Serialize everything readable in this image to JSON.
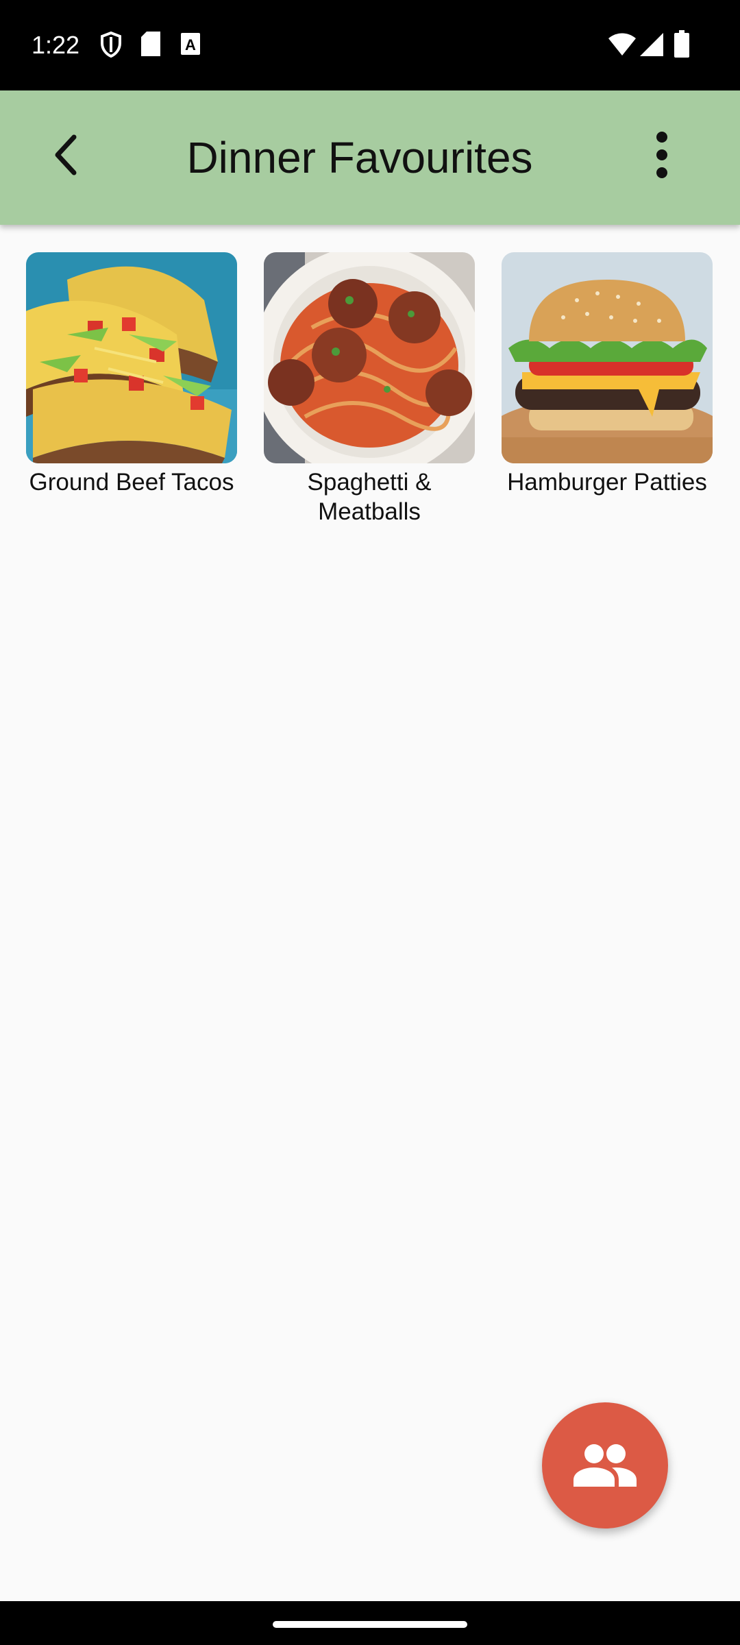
{
  "status_bar": {
    "time": "1:22",
    "icons": [
      "shield-icon",
      "sd-card-icon",
      "keyboard-a-icon",
      "wifi-icon",
      "cellular-signal-icon",
      "battery-icon"
    ]
  },
  "app_bar": {
    "title": "Dinner Favourites",
    "back_icon": "chevron-left-icon",
    "menu_icon": "more-vert-icon",
    "background": "#a7cca0"
  },
  "recipes": [
    {
      "name": "Ground Beef Tacos",
      "image": "tacos-photo"
    },
    {
      "name": "Spaghetti & Meatballs",
      "image": "spaghetti-meatballs-photo"
    },
    {
      "name": "Hamburger Patties",
      "image": "hamburger-photo"
    }
  ],
  "fab": {
    "icon": "people-icon",
    "color": "#dc5a45"
  },
  "page_background": "#fafafa"
}
